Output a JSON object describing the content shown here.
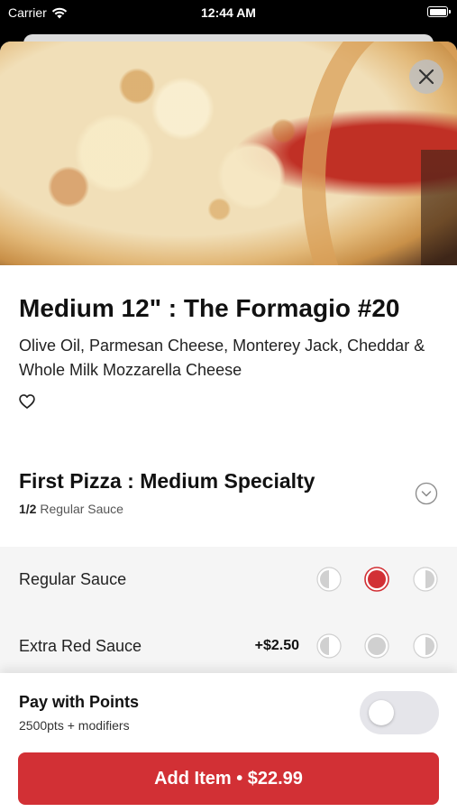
{
  "status_bar": {
    "carrier": "Carrier",
    "time": "12:44 AM"
  },
  "item": {
    "title": "Medium 12\" : The Formagio #20",
    "description": "Olive Oil, Parmesan Cheese, Monterey Jack, Cheddar & Whole Milk Mozzarella Cheese"
  },
  "section": {
    "title": "First Pizza : Medium Specialty",
    "count": "1/2",
    "selection": "Regular Sauce"
  },
  "options": [
    {
      "label": "Regular Sauce",
      "price": "",
      "selected": "whole"
    },
    {
      "label": "Extra Red Sauce",
      "price": "+$2.50",
      "selected": "none"
    }
  ],
  "points": {
    "title": "Pay with Points",
    "subtitle": "2500pts + modifiers",
    "enabled": false
  },
  "add_button": {
    "label": "Add Item • $22.99"
  },
  "colors": {
    "accent": "#d23035",
    "toggle_off": "#e5e5ea",
    "options_bg": "#f5f5f5"
  },
  "icons": {
    "wifi": "wifi-icon",
    "battery": "battery-icon",
    "close": "close-icon",
    "favorite": "heart-icon",
    "collapse": "chevron-down-icon",
    "half_left": "left-half-icon",
    "whole": "whole-icon",
    "half_right": "right-half-icon"
  }
}
